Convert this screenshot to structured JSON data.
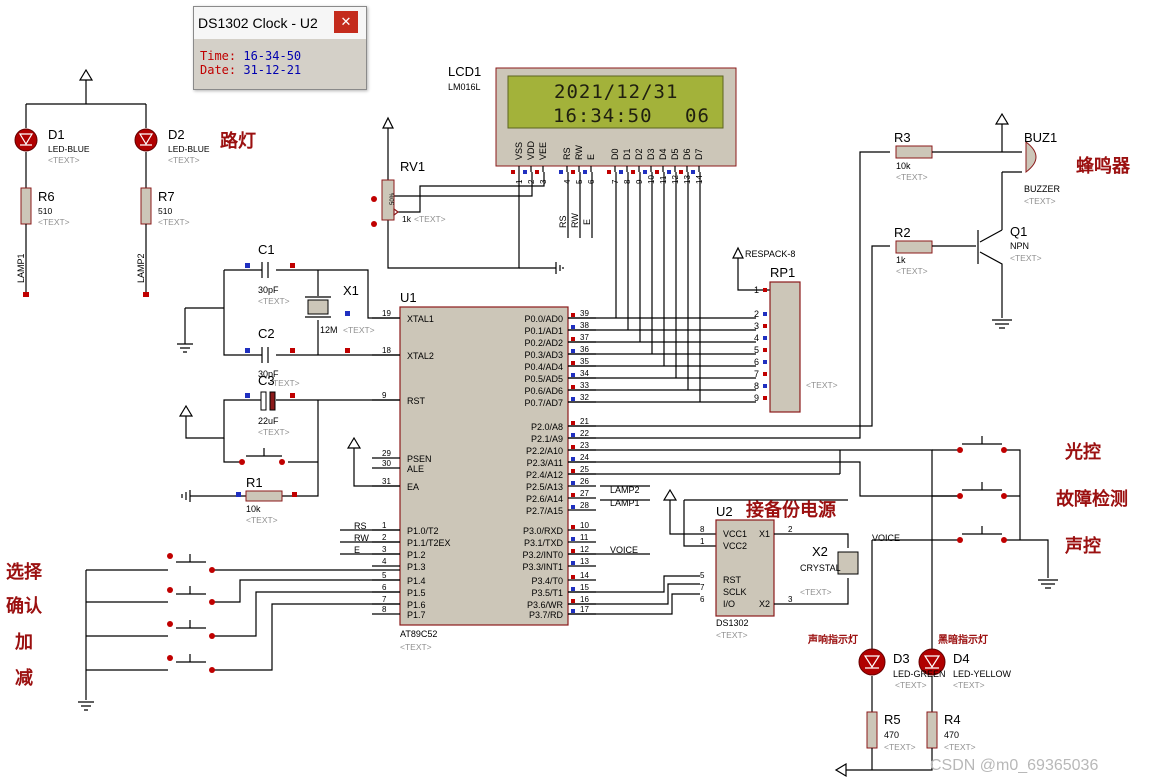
{
  "popup": {
    "title": "DS1302 Clock - U2",
    "close": "✕",
    "time_label": "Time:",
    "time_value": "16-34-50",
    "date_label": "Date:",
    "date_value": "31-12-21"
  },
  "lcd": {
    "ref": "LCD1",
    "model": "LM016L",
    "line1": "2021/12/31",
    "line2_time": "16:34:50",
    "line2_day": "06",
    "pins": [
      "VSS",
      "VDD",
      "VEE",
      "RS",
      "RW",
      "E",
      "D0",
      "D1",
      "D2",
      "D3",
      "D4",
      "D5",
      "D6",
      "D7"
    ],
    "pin_numbers": [
      "1",
      "2",
      "3",
      "4",
      "5",
      "6",
      "7",
      "8",
      "9",
      "10",
      "11",
      "12",
      "13",
      "14"
    ]
  },
  "text_placeholder": "<TEXT>",
  "mcu": {
    "ref": "U1",
    "model": "AT89C52",
    "left_pins": [
      {
        "num": "19",
        "name": "XTAL1"
      },
      {
        "num": "18",
        "name": "XTAL2"
      },
      {
        "num": "9",
        "name": "RST"
      },
      {
        "num": "29",
        "name": "PSEN"
      },
      {
        "num": "30",
        "name": "ALE"
      },
      {
        "num": "31",
        "name": "EA"
      },
      {
        "num": "1",
        "name": "P1.0/T2"
      },
      {
        "num": "2",
        "name": "P1.1/T2EX"
      },
      {
        "num": "3",
        "name": "P1.2"
      },
      {
        "num": "4",
        "name": "P1.3"
      },
      {
        "num": "5",
        "name": "P1.4"
      },
      {
        "num": "6",
        "name": "P1.5"
      },
      {
        "num": "7",
        "name": "P1.6"
      },
      {
        "num": "8",
        "name": "P1.7"
      }
    ],
    "right_pins": [
      {
        "num": "39",
        "name": "P0.0/AD0"
      },
      {
        "num": "38",
        "name": "P0.1/AD1"
      },
      {
        "num": "37",
        "name": "P0.2/AD2"
      },
      {
        "num": "36",
        "name": "P0.3/AD3"
      },
      {
        "num": "35",
        "name": "P0.4/AD4"
      },
      {
        "num": "34",
        "name": "P0.5/AD5"
      },
      {
        "num": "33",
        "name": "P0.6/AD6"
      },
      {
        "num": "32",
        "name": "P0.7/AD7"
      },
      {
        "num": "21",
        "name": "P2.0/A8"
      },
      {
        "num": "22",
        "name": "P2.1/A9"
      },
      {
        "num": "23",
        "name": "P2.2/A10"
      },
      {
        "num": "24",
        "name": "P2.3/A11"
      },
      {
        "num": "25",
        "name": "P2.4/A12"
      },
      {
        "num": "26",
        "name": "P2.5/A13"
      },
      {
        "num": "27",
        "name": "P2.6/A14"
      },
      {
        "num": "28",
        "name": "P2.7/A15"
      },
      {
        "num": "10",
        "name": "P3.0/RXD"
      },
      {
        "num": "11",
        "name": "P3.1/TXD"
      },
      {
        "num": "12",
        "name": "P3.2/INT0"
      },
      {
        "num": "13",
        "name": "P3.3/INT1"
      },
      {
        "num": "14",
        "name": "P3.4/T0"
      },
      {
        "num": "15",
        "name": "P3.5/T1"
      },
      {
        "num": "16",
        "name": "P3.6/WR"
      },
      {
        "num": "17",
        "name": "P3.7/RD"
      }
    ]
  },
  "ds1302": {
    "ref": "U2",
    "model": "DS1302",
    "left_pins": [
      {
        "num": "8",
        "name": "VCC1"
      },
      {
        "num": "1",
        "name": "VCC2"
      },
      {
        "num": "5",
        "name": "RST"
      },
      {
        "num": "7",
        "name": "SCLK"
      },
      {
        "num": "6",
        "name": "I/O"
      }
    ],
    "right_pins": [
      {
        "num": "2",
        "name": "X1"
      },
      {
        "num": "3",
        "name": "X2"
      }
    ]
  },
  "respack": {
    "ref": "RP1",
    "model": "RESPACK-8",
    "pins": [
      "1",
      "2",
      "3",
      "4",
      "5",
      "6",
      "7",
      "8",
      "9"
    ]
  },
  "components": {
    "d1": {
      "ref": "D1",
      "model": "LED-BLUE"
    },
    "d2": {
      "ref": "D2",
      "model": "LED-BLUE"
    },
    "d3": {
      "ref": "D3",
      "model": "LED-GREEN"
    },
    "d4": {
      "ref": "D4",
      "model": "LED-YELLOW"
    },
    "r1": {
      "ref": "R1",
      "value": "10k"
    },
    "r2": {
      "ref": "R2",
      "value": "1k"
    },
    "r3": {
      "ref": "R3",
      "value": "10k"
    },
    "r4": {
      "ref": "R4",
      "value": "470"
    },
    "r5": {
      "ref": "R5",
      "value": "470"
    },
    "r6": {
      "ref": "R6",
      "value": "510"
    },
    "r7": {
      "ref": "R7",
      "value": "510"
    },
    "rv1": {
      "ref": "RV1",
      "value": "1k",
      "pct": "50%"
    },
    "c1": {
      "ref": "C1",
      "value": "30pF"
    },
    "c2": {
      "ref": "C2",
      "value": "30pF"
    },
    "c3": {
      "ref": "C3",
      "value": "22uF"
    },
    "x1": {
      "ref": "X1",
      "value": "12M"
    },
    "x2": {
      "ref": "X2",
      "value": "CRYSTAL"
    },
    "q1": {
      "ref": "Q1",
      "value": "NPN"
    },
    "buz1": {
      "ref": "BUZ1",
      "value": "BUZZER"
    }
  },
  "nets": {
    "lamp1": "LAMP1",
    "lamp2": "LAMP2",
    "rs": "RS",
    "rw": "RW",
    "e": "E",
    "voice": "VOICE"
  },
  "labels": {
    "streetlight": "路灯",
    "buzzer": "蜂鸣器",
    "light_ctrl": "光控",
    "fault_detect": "故障检测",
    "sound_ctrl": "声控",
    "backup_power": "接备份电源",
    "sound_indicator": "声响指示灯",
    "dark_indicator": "黑暗指示灯",
    "select": "选择",
    "confirm": "确认",
    "add": "加",
    "sub": "减"
  },
  "watermark": "CSDN @m0_69365036"
}
